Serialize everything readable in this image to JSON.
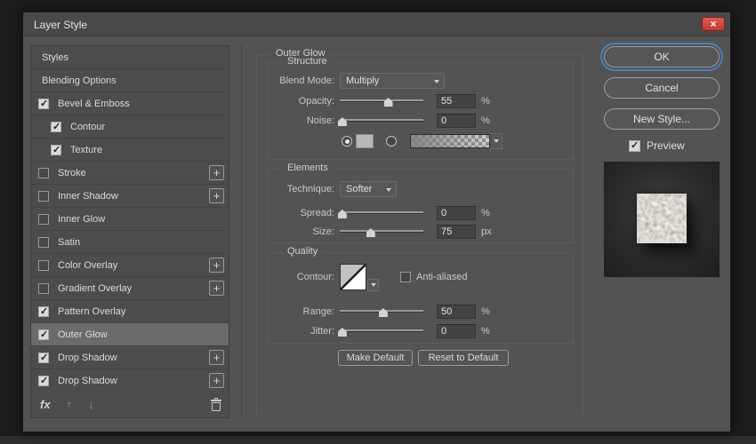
{
  "window": {
    "title": "Layer Style"
  },
  "icons": {
    "close": "×",
    "check": "✓",
    "plus": "+",
    "up": "↑",
    "down": "↓",
    "fx": "fx"
  },
  "sidebar": {
    "items": [
      {
        "label": "Styles",
        "state": "none"
      },
      {
        "label": "Blending Options",
        "state": "none"
      },
      {
        "label": "Bevel & Emboss",
        "state": "checked"
      },
      {
        "label": "Contour",
        "state": "checked",
        "indent": true
      },
      {
        "label": "Texture",
        "state": "checked",
        "indent": true
      },
      {
        "label": "Stroke",
        "state": "unchecked",
        "add": true
      },
      {
        "label": "Inner Shadow",
        "state": "unchecked",
        "add": true
      },
      {
        "label": "Inner Glow",
        "state": "unchecked"
      },
      {
        "label": "Satin",
        "state": "unchecked"
      },
      {
        "label": "Color Overlay",
        "state": "unchecked",
        "add": true
      },
      {
        "label": "Gradient Overlay",
        "state": "unchecked",
        "add": true
      },
      {
        "label": "Pattern Overlay",
        "state": "checked"
      },
      {
        "label": "Outer Glow",
        "state": "checked",
        "selected": true
      },
      {
        "label": "Drop Shadow",
        "state": "checked",
        "add": true
      },
      {
        "label": "Drop Shadow",
        "state": "checked",
        "add": true
      }
    ]
  },
  "main": {
    "title": "Outer Glow",
    "structure": {
      "legend": "Structure",
      "blend_mode_label": "Blend Mode:",
      "blend_mode_value": "Multiply",
      "opacity_label": "Opacity:",
      "opacity_value": "55",
      "opacity_unit": "%",
      "opacity_pct": 58,
      "noise_label": "Noise:",
      "noise_value": "0",
      "noise_unit": "%",
      "noise_pct": 3
    },
    "elements": {
      "legend": "Elements",
      "technique_label": "Technique:",
      "technique_value": "Softer",
      "spread_label": "Spread:",
      "spread_value": "0",
      "spread_unit": "%",
      "spread_pct": 3,
      "size_label": "Size:",
      "size_value": "75",
      "size_unit": "px",
      "size_pct": 37
    },
    "quality": {
      "legend": "Quality",
      "contour_label": "Contour:",
      "antialiased_label": "Anti-aliased",
      "range_label": "Range:",
      "range_value": "50",
      "range_unit": "%",
      "range_pct": 52,
      "jitter_label": "Jitter:",
      "jitter_value": "0",
      "jitter_unit": "%",
      "jitter_pct": 3
    },
    "footer_buttons": {
      "make_default": "Make Default",
      "reset_to_default": "Reset to Default"
    }
  },
  "actions": {
    "ok": "OK",
    "cancel": "Cancel",
    "new_style": "New Style...",
    "preview": "Preview"
  },
  "colors": {
    "dialog_bg": "#535353",
    "selected_item_bg": "#6b6b6b",
    "focus_ring_blue": "#4a7fc1",
    "close_button_red": "#d6473c",
    "glow_color_swatch": "#b9b9b9"
  }
}
